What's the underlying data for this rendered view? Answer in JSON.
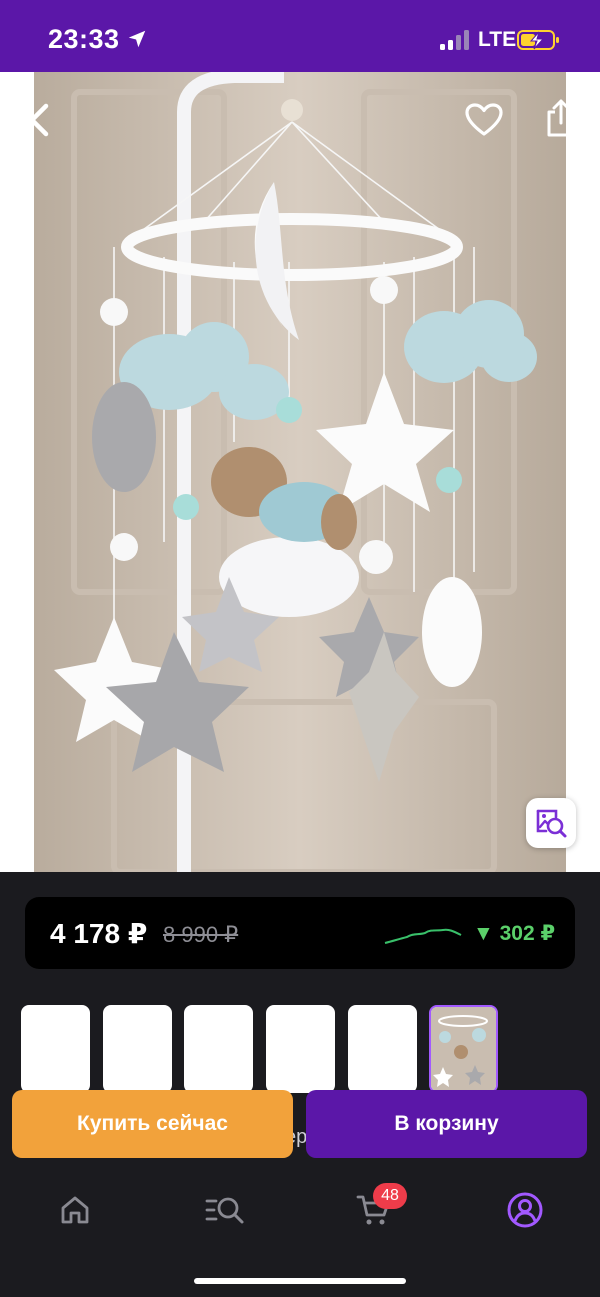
{
  "status_bar": {
    "time": "23:33",
    "network": "LTE",
    "icons": [
      "location-arrow-icon",
      "signal-icon",
      "battery-charging-icon"
    ],
    "background_color": "#5b17a8"
  },
  "product_photo": {
    "icons": [
      "back-arrow-icon",
      "heart-icon",
      "share-icon",
      "visual-search-icon"
    ]
  },
  "price": {
    "current": "4 178 ₽",
    "old": "8 990 ₽",
    "drop": "302 ₽",
    "drop_color": "#5bd06a"
  },
  "gallery": {
    "thumbnail_count": 6,
    "active_index": 5,
    "partial_text_behind_buttons": "ер"
  },
  "actions": {
    "buy_now": "Купить сейчас",
    "add_to_cart": "В корзину",
    "buy_color": "#f2a23b",
    "cart_color": "#5b17a8"
  },
  "bottom_nav": {
    "items": [
      {
        "icon": "home-icon"
      },
      {
        "icon": "catalog-search-icon"
      },
      {
        "icon": "cart-icon"
      },
      {
        "icon": "profile-icon"
      }
    ],
    "cart_badge": "48",
    "active_color": "#a259ff"
  }
}
